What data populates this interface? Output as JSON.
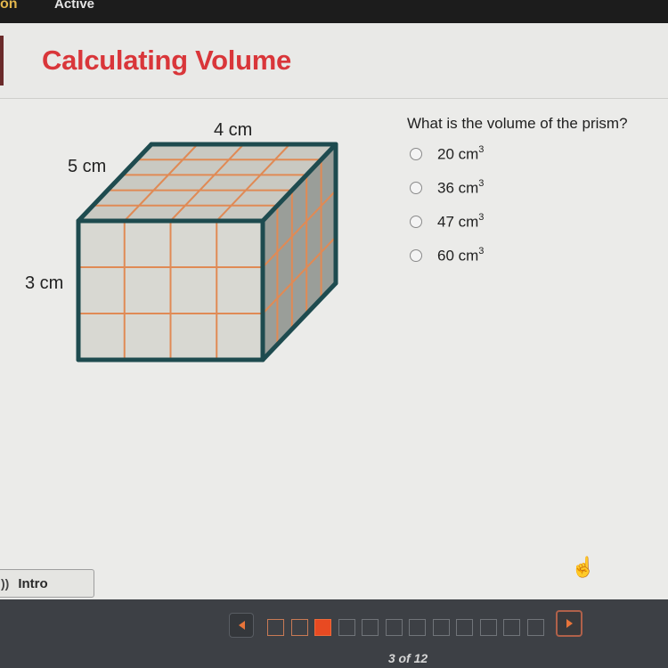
{
  "topbar": {
    "partial_tab": "on",
    "active_tab": "Active"
  },
  "header": {
    "title": "Calculating Volume"
  },
  "figure": {
    "shape": "rectangular prism",
    "dimensions": {
      "length_label": "4 cm",
      "width_label": "5 cm",
      "height_label": "3 cm"
    },
    "grid": {
      "columns": 4,
      "depth": 5,
      "rows": 3
    },
    "colors": {
      "edge": "#1e4b4f",
      "grid_line": "#e08a55",
      "front_face": "#d8d8d2",
      "top_face": "#c9c9c2",
      "side_face": "#9a9e99"
    }
  },
  "question": {
    "prompt": "What is the volume of the prism?",
    "options": [
      {
        "value": "20 cm",
        "exp": "3",
        "selected": false
      },
      {
        "value": "36 cm",
        "exp": "3",
        "selected": false
      },
      {
        "value": "47 cm",
        "exp": "3",
        "selected": false
      },
      {
        "value": "60 cm",
        "exp": "3",
        "selected": false
      }
    ]
  },
  "intro_button": {
    "icon": "audio-icon",
    "label": "Intro"
  },
  "footer": {
    "prev_icon": "triangle-left-icon",
    "next_icon": "triangle-right-icon",
    "current_page": 3,
    "total_pages": 12,
    "pages_visited": 2,
    "page_count_text": "3 of 12",
    "accent_color": "#e84a22"
  }
}
